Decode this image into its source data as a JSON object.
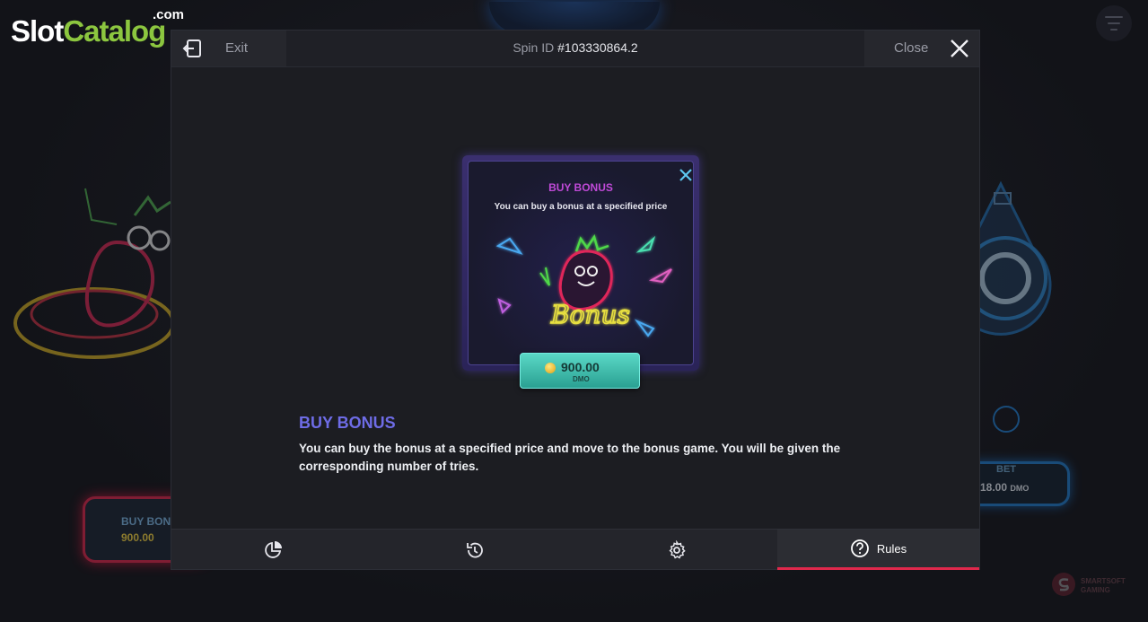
{
  "logo": {
    "part1": "Slot",
    "part2": "Catalog",
    "suffix": ".com"
  },
  "modal": {
    "exit_label": "Exit",
    "spin_id_label": "Spin ID",
    "spin_id_value": "#103330864.2",
    "close_label": "Close"
  },
  "card": {
    "title": "BUY BONUS",
    "subtitle": "You can buy a bonus at a specified price",
    "art_text": "Bonus",
    "price_value": "900.00",
    "price_currency": "DMO"
  },
  "rules": {
    "title": "BUY BONUS",
    "body": "You can buy the bonus at a specified price and move to the bonus game. You will be given the corresponding number of tries."
  },
  "tabs": [
    {
      "icon": "pie-chart-icon",
      "label": ""
    },
    {
      "icon": "history-icon",
      "label": ""
    },
    {
      "icon": "gear-icon",
      "label": ""
    },
    {
      "icon": "help-circle-icon",
      "label": "Rules"
    }
  ],
  "active_tab": "Rules",
  "background": {
    "buy_bonus_label": "BUY BONUS",
    "buy_bonus_value": "900.00",
    "bet_label": "BET",
    "bet_value": "18.00",
    "bet_currency": "DMO",
    "brand_line1": "SMARTSOFT",
    "brand_line2": "GAMING"
  },
  "colors": {
    "accent_red": "#e0284c",
    "title_purple": "#6e6ce6",
    "card_title": "#c04ad8",
    "price_button": "#3cbfae",
    "logo_green": "#8cc63f"
  }
}
